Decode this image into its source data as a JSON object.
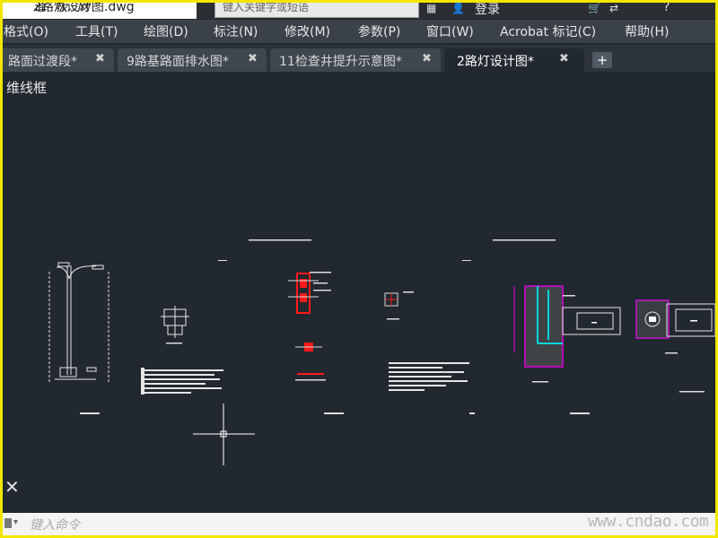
{
  "window": {
    "file_title": "2路灯设计图.dwg",
    "search_placeholder": "键入关键字或短语",
    "login_label": "登录",
    "logo_text": "道 板 网"
  },
  "menubar": {
    "items": [
      "格式(O)",
      "工具(T)",
      "绘图(D)",
      "标注(N)",
      "修改(M)",
      "参数(P)",
      "窗口(W)",
      "Acrobat 标记(C)",
      "帮助(H)"
    ]
  },
  "tabs": [
    {
      "label": "路面过渡段*",
      "active": false
    },
    {
      "label": "9路基路面排水图*",
      "active": false
    },
    {
      "label": "11检查井提升示意图*",
      "active": false
    },
    {
      "label": "2路灯设计图*",
      "active": true
    }
  ],
  "viewport": {
    "label": "维线框"
  },
  "command_line": {
    "placeholder": "键入命令"
  },
  "watermark": "www.cndao.com",
  "colors": {
    "canvas": "#212830",
    "border": "#f3e600",
    "red": "#ff1a1a",
    "magenta": "#e000e0",
    "cyan": "#00d7e0"
  },
  "icons": [
    "search-icon",
    "user-icon",
    "cart-icon",
    "help-icon",
    "close-icon",
    "add-tab-icon",
    "crosshair-cursor-icon"
  ]
}
